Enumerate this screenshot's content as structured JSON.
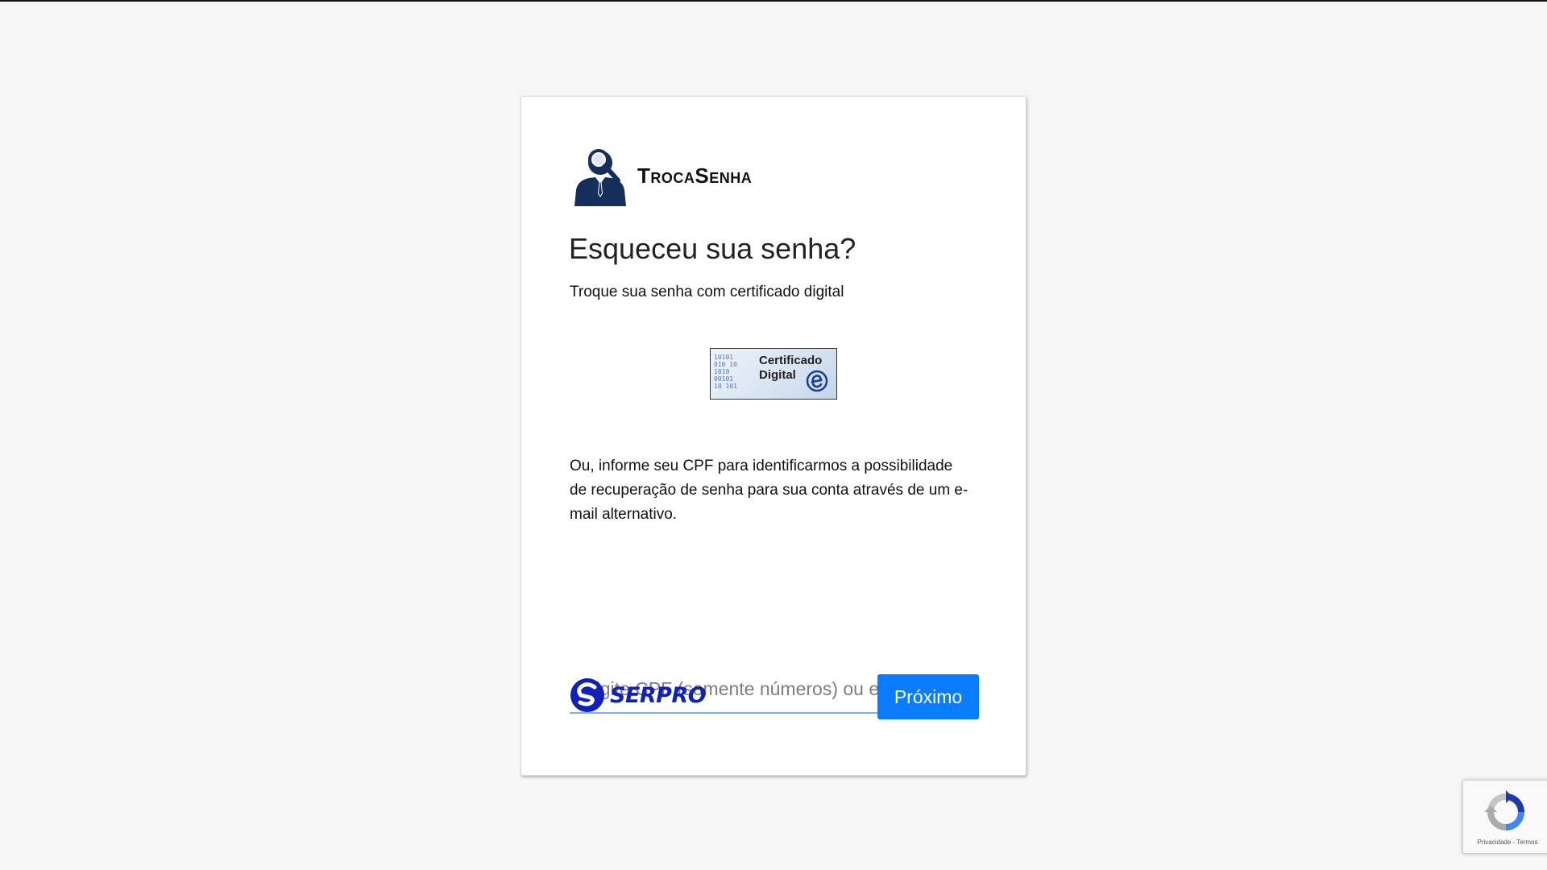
{
  "brand": {
    "name": "TrocaSenha",
    "icon": "person-search-icon"
  },
  "page": {
    "title": "Esqueceu sua senha?",
    "subtitle": "Troque sua senha com certificado digital"
  },
  "certificate_button": {
    "line1": "Certificado",
    "line2": "Digital",
    "digits": "10101\n010 10\n1010\n00101\n10 101"
  },
  "info_text": "Ou, informe seu CPF para identificarmos a possibilidade de recuperação de senha para sua conta através de um e-mail alternativo.",
  "form": {
    "input_value": "",
    "input_placeholder": "Digite CPF (somente números) ou e-mail",
    "next_label": "Próximo"
  },
  "footer": {
    "serpro_name": "SERPRO"
  },
  "recaptcha": {
    "privacy": "Privacidade",
    "separator": " - ",
    "terms": "Termos"
  },
  "colors": {
    "accent": "#0a7cff",
    "input_underline": "#7ab0f0",
    "serpro_blue": "#1020b8",
    "brand_icon": "#14305a"
  }
}
